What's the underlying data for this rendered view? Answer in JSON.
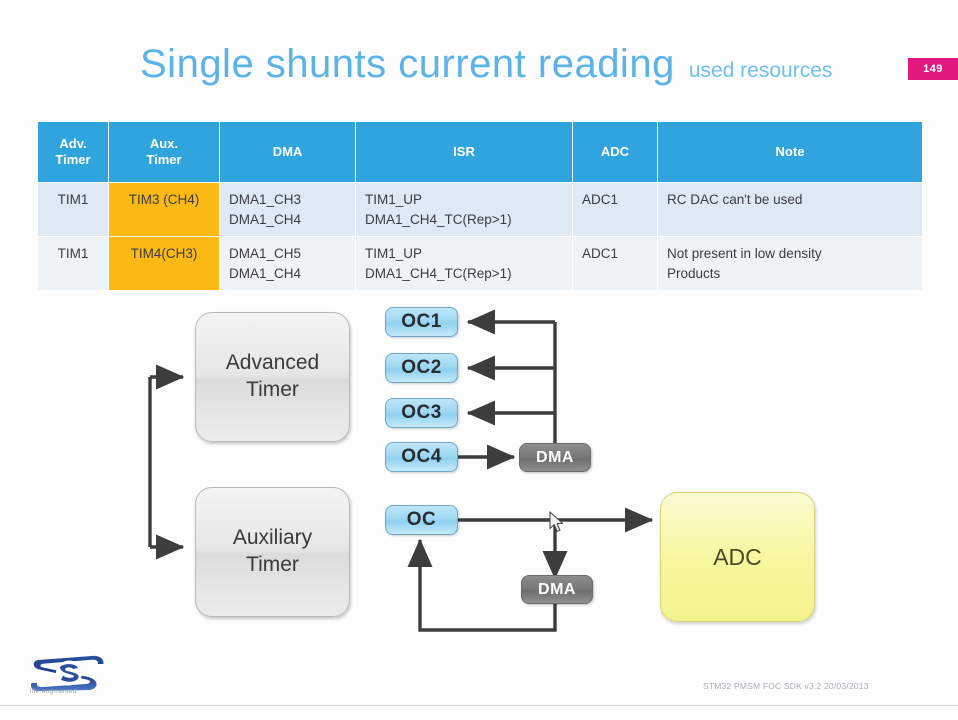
{
  "title": {
    "main": "Single  shunts current reading",
    "sub": "used resources",
    "page_number": "149",
    "accent_color": "#5cb3e8",
    "badge_color": "#e2197f"
  },
  "table": {
    "header_color": "#2fa4dd",
    "highlight_color": "#fdb913",
    "columns": [
      {
        "label_line1": "Adv.",
        "label_line2": "Timer"
      },
      {
        "label_line1": "Aux.",
        "label_line2": "Timer"
      },
      {
        "label_line1": "DMA",
        "label_line2": ""
      },
      {
        "label_line1": "ISR",
        "label_line2": ""
      },
      {
        "label_line1": "ADC",
        "label_line2": ""
      },
      {
        "label_line1": "Note",
        "label_line2": ""
      }
    ],
    "rows": [
      {
        "adv_timer": "TIM1",
        "aux_timer": "TIM3 (CH4)",
        "dma_line1": "DMA1_CH3",
        "dma_line2": "DMA1_CH4",
        "isr_line1": "TIM1_UP",
        "isr_line2": "DMA1_CH4_TC(Rep>1)",
        "adc": "ADC1",
        "note_line1": "RC DAC can't be used",
        "note_line2": ""
      },
      {
        "adv_timer": "TIM1",
        "aux_timer": "TIM4(CH3)",
        "dma_line1": "DMA1_CH5",
        "dma_line2": "DMA1_CH4",
        "isr_line1": "TIM1_UP",
        "isr_line2": "DMA1_CH4_TC(Rep>1)",
        "adc": "ADC1",
        "note_line1": "Not present  in low density",
        "note_line2": "Products"
      }
    ]
  },
  "diagram": {
    "advanced_timer_line1": "Advanced",
    "advanced_timer_line2": "Timer",
    "auxiliary_timer_line1": "Auxiliary",
    "auxiliary_timer_line2": "Timer",
    "oc1": "OC1",
    "oc2": "OC2",
    "oc3": "OC3",
    "oc4": "OC4",
    "oc_aux": "OC",
    "dma_top": "DMA",
    "dma_bottom": "DMA",
    "adc": "ADC",
    "oc_box_color": "#9ed8f3",
    "dma_box_color": "#777777",
    "adc_box_color": "#f7f79d",
    "timer_box_color": "#e6e6e6"
  },
  "footer": {
    "logo_text": "ST",
    "logo_tagline": "life.augmented",
    "doc_info": "STM32 PMSM FOC SDK v3.2   20/03/2013"
  }
}
